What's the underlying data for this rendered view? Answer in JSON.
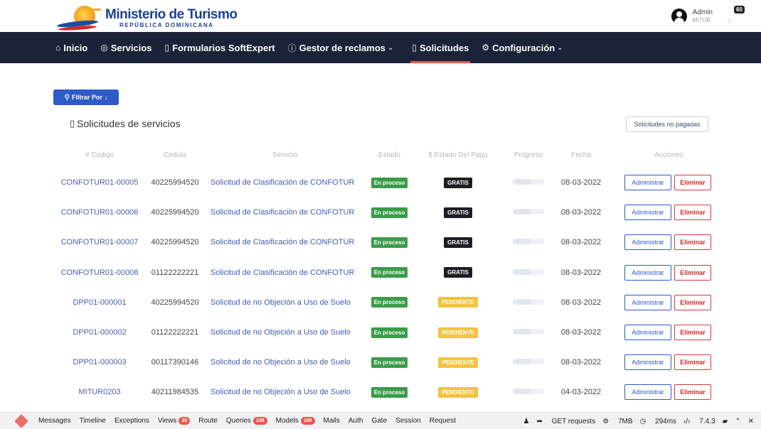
{
  "header": {
    "logo_title": "Ministerio de Turismo",
    "logo_subtitle": "REPÚBLICA DOMINICANA",
    "user_name": "Admin",
    "user_role": "MITUR",
    "notification_count": "60"
  },
  "nav": {
    "items": [
      {
        "label": "Inicio",
        "icon": "home-icon"
      },
      {
        "label": "Servicios",
        "icon": "box-icon"
      },
      {
        "label": "Formularios SoftExpert",
        "icon": "clipboard-icon"
      },
      {
        "label": "Gestor de reclamos",
        "icon": "info-icon"
      },
      {
        "label": "Solicitudes",
        "icon": "clipboard-icon",
        "active": true
      },
      {
        "label": "Configuración",
        "icon": "gear-icon"
      }
    ]
  },
  "filter_label": "Filtrar Por",
  "section_title": "Solicitudes de servicios",
  "unpaid_button": "Solicitudes no pagadas",
  "table": {
    "headers": [
      "# Codigo",
      "Cedula",
      "Servicio",
      "Estado",
      "$ Estado Del Pago",
      "Progreso",
      "Fecha",
      "Acciones"
    ],
    "rows": [
      {
        "code": "CONFOTUR01-00005",
        "cedula": "40225994520",
        "servicio": "Solicitud de Clasificación de CONFOTUR",
        "estado": "En proceso",
        "pago": "GRATIS",
        "fecha": "08-03-2022"
      },
      {
        "code": "CONFOTUR01-00006",
        "cedula": "40225994520",
        "servicio": "Solicitud de Clasificación de CONFOTUR",
        "estado": "En proceso",
        "pago": "GRATIS",
        "fecha": "08-03-2022"
      },
      {
        "code": "CONFOTUR01-00007",
        "cedula": "40225994520",
        "servicio": "Solicitud de Clasificación de CONFOTUR",
        "estado": "En proceso",
        "pago": "GRATIS",
        "fecha": "08-03-2022"
      },
      {
        "code": "CONFOTUR01-00008",
        "cedula": "01122222221",
        "servicio": "Solicitud de Clasificación de CONFOTUR",
        "estado": "En proceso",
        "pago": "GRATIS",
        "fecha": "08-03-2022"
      },
      {
        "code": "DPP01-000001",
        "cedula": "40225994520",
        "servicio": "Solicitud de no Objeción a Uso de Suelo",
        "estado": "En proceso",
        "pago": "PENDIENTE",
        "fecha": "08-03-2022"
      },
      {
        "code": "DPP01-000002",
        "cedula": "01122222221",
        "servicio": "Solicitud de no Objeción a Uso de Suelo",
        "estado": "En proceso",
        "pago": "PENDIENTE",
        "fecha": "08-03-2022"
      },
      {
        "code": "DPP01-000003",
        "cedula": "00117390146",
        "servicio": "Solicitud de no Objeción a Uso de Suelo",
        "estado": "En proceso",
        "pago": "PENDIENTE",
        "fecha": "08-03-2022"
      },
      {
        "code": "MITUR0203",
        "cedula": "40211984535",
        "servicio": "Solicitud de no Objeción a Uso de Suelo",
        "estado": "En proceso",
        "pago": "PENDIENTE",
        "fecha": "04-03-2022"
      }
    ],
    "action_admin": "Administrar",
    "action_delete": "Eliminar"
  },
  "debugbar": {
    "items": [
      {
        "label": "Messages"
      },
      {
        "label": "Timeline"
      },
      {
        "label": "Exceptions"
      },
      {
        "label": "Views",
        "badge": "30"
      },
      {
        "label": "Route"
      },
      {
        "label": "Queries",
        "badge": "108"
      },
      {
        "label": "Models",
        "badge": "169"
      },
      {
        "label": "Mails"
      },
      {
        "label": "Auth"
      },
      {
        "label": "Gate"
      },
      {
        "label": "Session"
      },
      {
        "label": "Request"
      }
    ],
    "request": "GET requests",
    "memory": "7MB",
    "time": "294ms",
    "php": "7.4.3"
  },
  "colors": {
    "nav_bg": "#1a2338",
    "primary": "#2d5bc7",
    "danger": "#d33a3a",
    "success": "#3a9c48",
    "warning": "#f4c23d"
  }
}
